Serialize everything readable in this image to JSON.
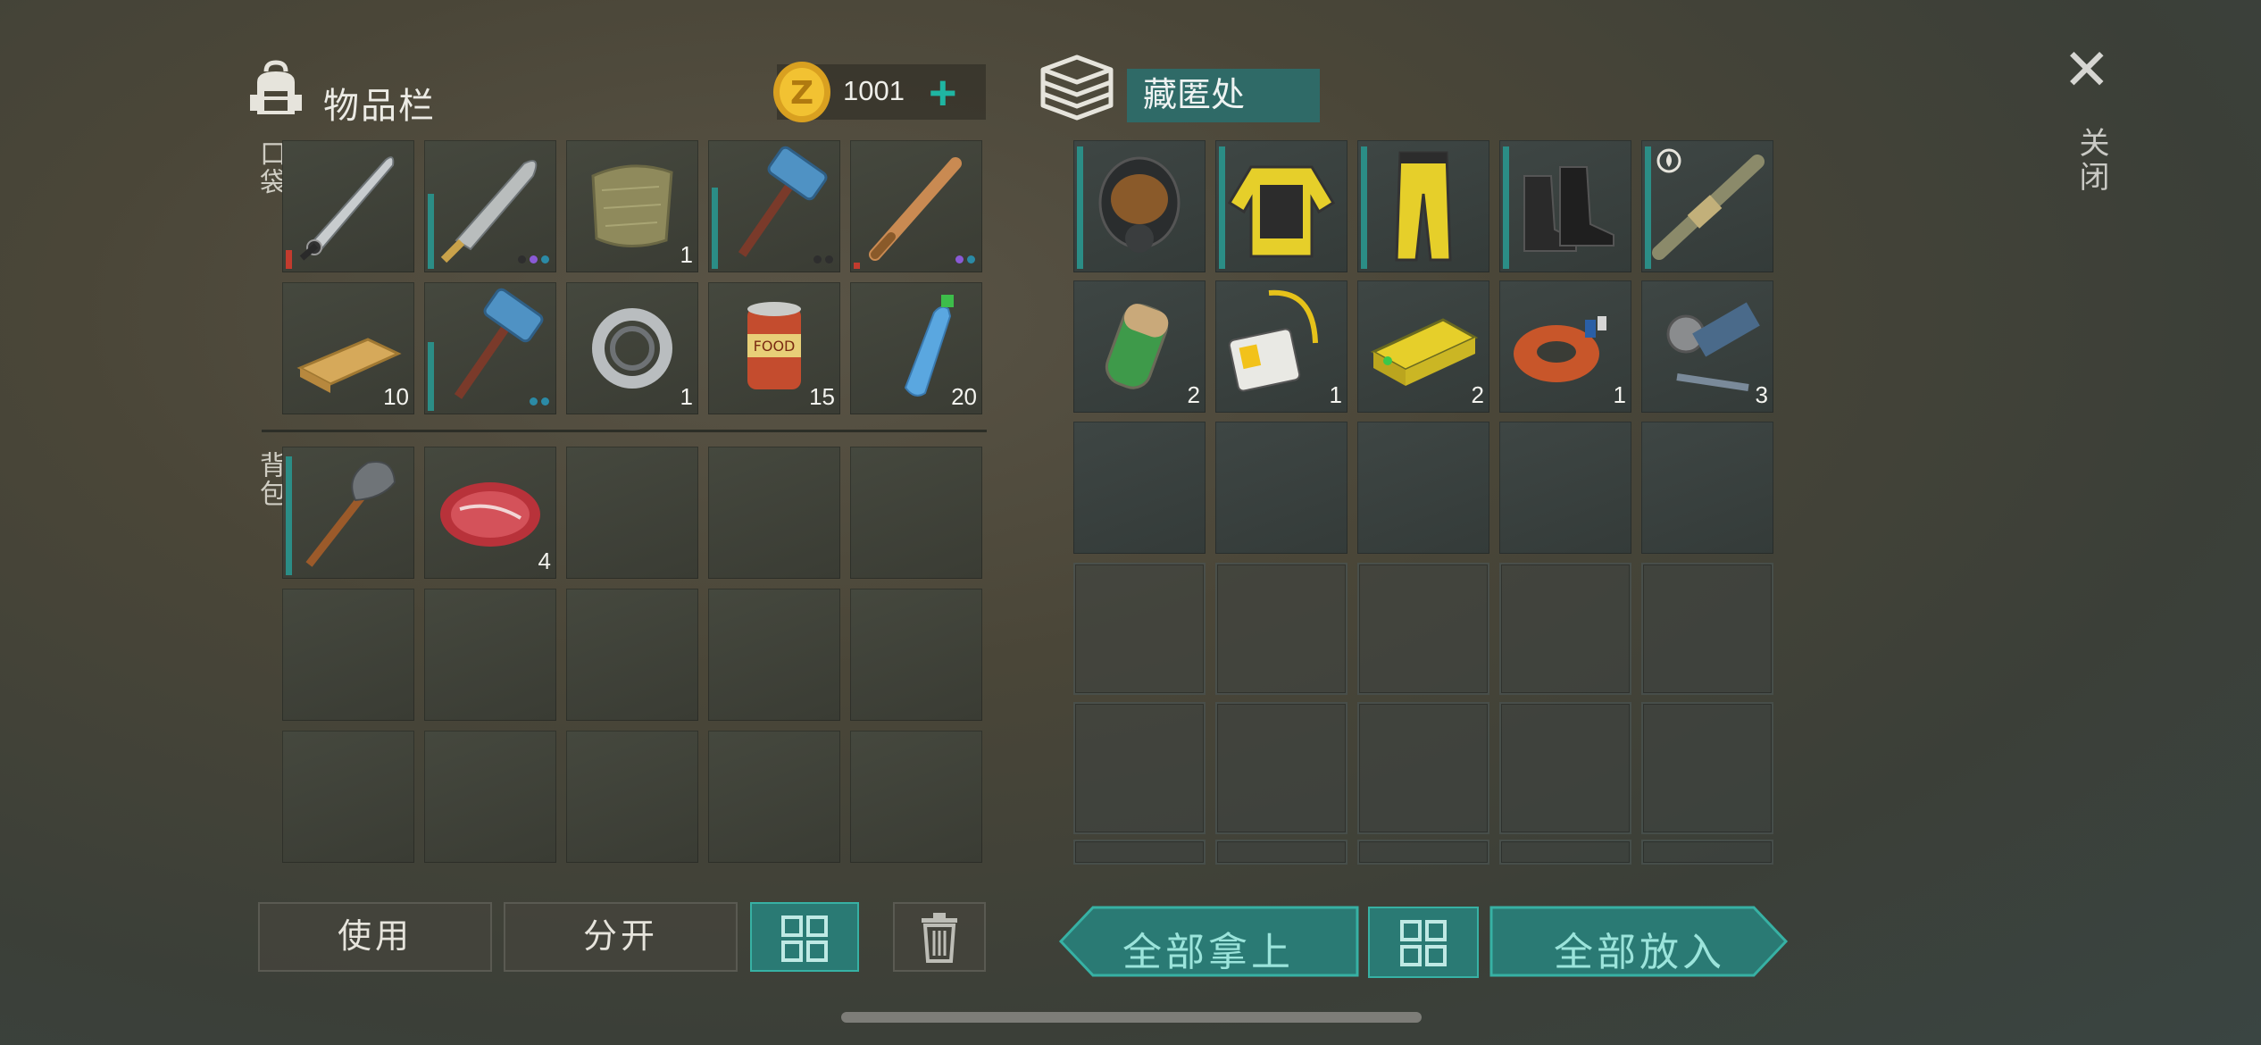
{
  "inventory": {
    "title": "物品栏",
    "pocket_label": "口袋",
    "backpack_label": "背包",
    "coins": "1001",
    "add_symbol": "+",
    "pockets": [
      {
        "icon": "machete-icon",
        "count": "",
        "durability": 0.15,
        "dur_color": "#c23b2e",
        "dots": []
      },
      {
        "icon": "cleaver-machete-icon",
        "count": "",
        "durability": 0.6,
        "dur_color": "#2b8d86",
        "dots": [
          "#2e2e2e",
          "#8a5ad6",
          "#2b8aa6"
        ]
      },
      {
        "icon": "cloth-scrap-icon",
        "count": "1",
        "durability": 0,
        "dur_color": "",
        "dots": []
      },
      {
        "icon": "sledgehammer-icon",
        "count": "",
        "durability": 0.65,
        "dur_color": "#2b8d86",
        "dots": [
          "#2e2e2e",
          "#2e2e2e"
        ]
      },
      {
        "icon": "baseball-bat-icon",
        "count": "",
        "durability": 0.05,
        "dur_color": "#c23b2e",
        "dots": [
          "#8a5ad6",
          "#2b8aa6"
        ]
      },
      {
        "icon": "wood-plank-icon",
        "count": "10",
        "durability": 0,
        "dur_color": "",
        "dots": []
      },
      {
        "icon": "sledgehammer-icon",
        "count": "",
        "durability": 0.55,
        "dur_color": "#2b8d86",
        "dots": [
          "#2b8aa6",
          "#2b8aa6"
        ]
      },
      {
        "icon": "bearing-icon",
        "count": "1",
        "durability": 0,
        "dur_color": "",
        "dots": []
      },
      {
        "icon": "canned-food-icon",
        "count": "15",
        "durability": 0,
        "dur_color": "",
        "dots": []
      },
      {
        "icon": "water-bottle-icon",
        "count": "20",
        "durability": 0,
        "dur_color": "",
        "dots": []
      }
    ],
    "backpack": [
      {
        "icon": "shovel-icon",
        "count": "",
        "durability": 0.95,
        "dur_color": "#2b8d86",
        "dots": []
      },
      {
        "icon": "raw-meat-icon",
        "count": "4",
        "durability": 0,
        "dur_color": "",
        "dots": []
      },
      {
        "icon": "",
        "count": ""
      },
      {
        "icon": "",
        "count": ""
      },
      {
        "icon": "",
        "count": ""
      },
      {
        "icon": "",
        "count": ""
      },
      {
        "icon": "",
        "count": ""
      },
      {
        "icon": "",
        "count": ""
      },
      {
        "icon": "",
        "count": ""
      },
      {
        "icon": "",
        "count": ""
      },
      {
        "icon": "",
        "count": ""
      },
      {
        "icon": "",
        "count": ""
      },
      {
        "icon": "",
        "count": ""
      },
      {
        "icon": "",
        "count": ""
      },
      {
        "icon": "",
        "count": ""
      }
    ]
  },
  "stash": {
    "title": "藏匿处",
    "slots": [
      {
        "icon": "gas-mask-icon",
        "count": "",
        "durability": 0.98,
        "dur_color": "#2b8d86"
      },
      {
        "icon": "hazmat-jacket-icon",
        "count": "",
        "durability": 0.98,
        "dur_color": "#2b8d86"
      },
      {
        "icon": "hazmat-pants-icon",
        "count": "",
        "durability": 0.98,
        "dur_color": "#2b8d86"
      },
      {
        "icon": "boots-icon",
        "count": "",
        "durability": 0.98,
        "dur_color": "#2b8d86"
      },
      {
        "icon": "flamethrower-icon",
        "count": "",
        "durability": 0.98,
        "dur_color": "#2b8d86",
        "badge": "flame-badge-icon"
      },
      {
        "icon": "filter-canister-icon",
        "count": "2"
      },
      {
        "icon": "id-badge-icon",
        "count": "1"
      },
      {
        "icon": "battery-pack-icon",
        "count": "2"
      },
      {
        "icon": "copper-coil-icon",
        "count": "1"
      },
      {
        "icon": "engine-parts-icon",
        "count": "3"
      }
    ]
  },
  "buttons": {
    "use": "使用",
    "split": "分开",
    "take_all": "全部拿上",
    "put_all": "全部放入"
  },
  "close": {
    "symbol": "✕",
    "label": "关闭"
  },
  "colors": {
    "accent": "#2a7a74",
    "accent_border": "#37b1a4",
    "arrow_text": "#9be4db"
  }
}
